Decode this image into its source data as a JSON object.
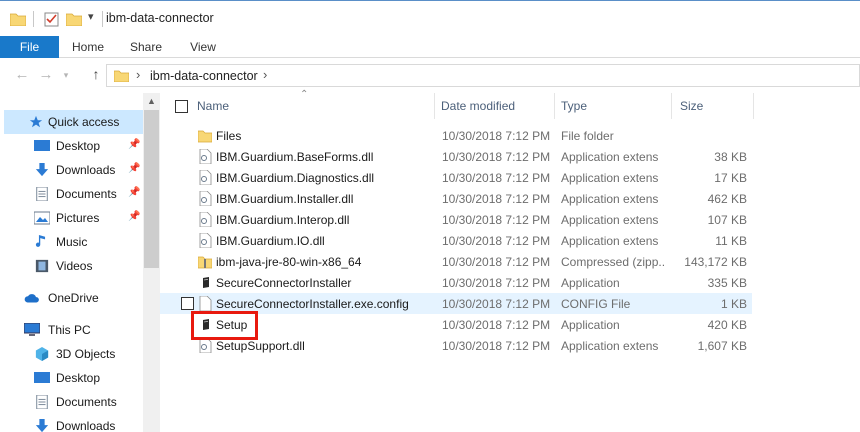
{
  "window": {
    "title": "ibm-data-connector"
  },
  "ribbon": {
    "tabs": [
      {
        "label": "File"
      },
      {
        "label": "Home"
      },
      {
        "label": "Share"
      },
      {
        "label": "View"
      }
    ]
  },
  "address": {
    "path": "ibm-data-connector"
  },
  "nav": {
    "items": [
      {
        "label": "Quick access",
        "icon": "star-icon",
        "pinned": false
      },
      {
        "label": "Desktop",
        "icon": "desktop-icon",
        "pinned": true
      },
      {
        "label": "Downloads",
        "icon": "download-icon",
        "pinned": true
      },
      {
        "label": "Documents",
        "icon": "documents-icon",
        "pinned": true
      },
      {
        "label": "Pictures",
        "icon": "pictures-icon",
        "pinned": true
      },
      {
        "label": "Music",
        "icon": "music-icon",
        "pinned": false
      },
      {
        "label": "Videos",
        "icon": "videos-icon",
        "pinned": false
      },
      {
        "label": "OneDrive",
        "icon": "cloud-icon",
        "pinned": false
      },
      {
        "label": "This PC",
        "icon": "computer-icon",
        "pinned": false
      },
      {
        "label": "3D Objects",
        "icon": "cube-icon",
        "pinned": false
      },
      {
        "label": "Desktop",
        "icon": "desktop-icon",
        "pinned": false
      },
      {
        "label": "Documents",
        "icon": "documents-icon",
        "pinned": false
      },
      {
        "label": "Downloads",
        "icon": "download-icon",
        "pinned": false
      }
    ]
  },
  "columns": {
    "name": "Name",
    "date": "Date modified",
    "type": "Type",
    "size": "Size"
  },
  "files": [
    {
      "name": "Files",
      "date": "10/30/2018 7:12 PM",
      "type": "File folder",
      "size": "",
      "icon": "folder-icon"
    },
    {
      "name": "IBM.Guardium.BaseForms.dll",
      "date": "10/30/2018 7:12 PM",
      "type": "Application extens",
      "size": "38 KB",
      "icon": "dll-icon"
    },
    {
      "name": "IBM.Guardium.Diagnostics.dll",
      "date": "10/30/2018 7:12 PM",
      "type": "Application extens",
      "size": "17 KB",
      "icon": "dll-icon"
    },
    {
      "name": "IBM.Guardium.Installer.dll",
      "date": "10/30/2018 7:12 PM",
      "type": "Application extens",
      "size": "462 KB",
      "icon": "dll-icon"
    },
    {
      "name": "IBM.Guardium.Interop.dll",
      "date": "10/30/2018 7:12 PM",
      "type": "Application extens",
      "size": "107 KB",
      "icon": "dll-icon"
    },
    {
      "name": "IBM.Guardium.IO.dll",
      "date": "10/30/2018 7:12 PM",
      "type": "Application extens",
      "size": "11 KB",
      "icon": "dll-icon"
    },
    {
      "name": "ibm-java-jre-80-win-x86_64",
      "date": "10/30/2018 7:12 PM",
      "type": "Compressed (zipp...",
      "size": "143,172 KB",
      "icon": "zip-folder-icon"
    },
    {
      "name": "SecureConnectorInstaller",
      "date": "10/30/2018 7:12 PM",
      "type": "Application",
      "size": "335 KB",
      "icon": "installer-icon"
    },
    {
      "name": "SecureConnectorInstaller.exe.config",
      "date": "10/30/2018 7:12 PM",
      "type": "CONFIG File",
      "size": "1 KB",
      "icon": "config-file-icon"
    },
    {
      "name": "Setup",
      "date": "10/30/2018 7:12 PM",
      "type": "Application",
      "size": "420 KB",
      "icon": "installer-icon"
    },
    {
      "name": "SetupSupport.dll",
      "date": "10/30/2018 7:12 PM",
      "type": "Application extens",
      "size": "1,607 KB",
      "icon": "dll-icon"
    }
  ],
  "highlight": {
    "hovered_row": 8,
    "marked_row": 9,
    "marker_color": "#e8190f"
  },
  "colors": {
    "accent": "#1979ca",
    "selection": "#cce8ff",
    "hover": "#e5f3ff"
  }
}
